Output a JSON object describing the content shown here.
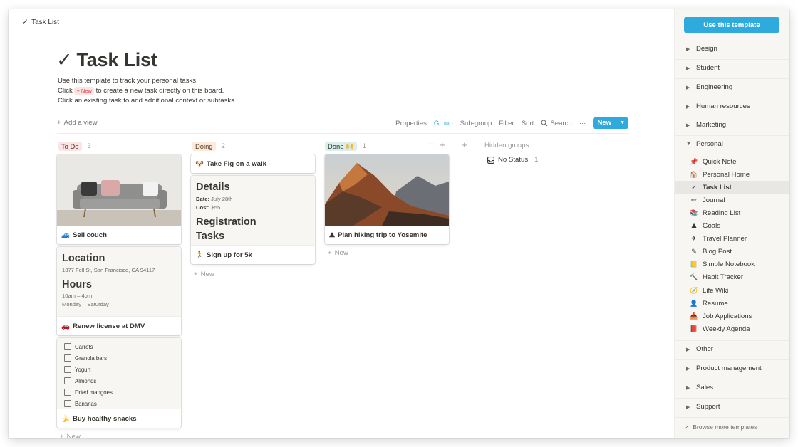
{
  "topbar": {
    "icon": "✓",
    "title": "Task List"
  },
  "page": {
    "title": "Task List",
    "title_icon": "✓",
    "description_line1": "Use this template to track your personal tasks.",
    "description_line2_pre": "Click",
    "description_line2_pill": "+ New",
    "description_line2_post": "to create a new task directly on this board.",
    "description_line3": "Click an existing task to add additional context or subtasks."
  },
  "viewbar": {
    "add_view": "Add a view",
    "properties": "Properties",
    "group": "Group",
    "subgroup": "Sub-group",
    "filter": "Filter",
    "sort": "Sort",
    "search": "Search",
    "more": "···",
    "new": "New"
  },
  "columns": [
    {
      "label": "To Do",
      "count": "3",
      "color": "#fbe4e4",
      "text_color": "#5a1e1e"
    },
    {
      "label": "Doing",
      "count": "2",
      "color": "#faebdd",
      "text_color": "#5a3a1a"
    },
    {
      "label": "Done 🙌",
      "count": "1",
      "color": "#ddedea",
      "text_color": "#1a3a2a"
    }
  ],
  "cards": {
    "sell_couch": {
      "emoji": "🚙",
      "title": "Sell couch"
    },
    "renew_license": {
      "emoji": "🚗",
      "title": "Renew license at DMV",
      "h1": "Location",
      "address": "1377 Fell St, San Francisco, CA 94117",
      "h2": "Hours",
      "hours1": "10am – 4pm",
      "hours2": "Monday – Saturday"
    },
    "snacks": {
      "emoji": "🍌",
      "title": "Buy healthy snacks",
      "items": [
        "Carrots",
        "Granola bars",
        "Yogurt",
        "Almonds",
        "Dried mangoes",
        "Bananas"
      ]
    },
    "fig_walk": {
      "emoji": "🐶",
      "title": "Take Fig on a walk"
    },
    "signup_5k": {
      "emoji": "🏃",
      "title": "Sign up for 5k",
      "h1": "Details",
      "date_label": "Date:",
      "date_value": "July 28th",
      "cost_label": "Cost:",
      "cost_value": "$55",
      "h2": "Registration",
      "h3": "Tasks"
    },
    "hiking": {
      "emoji": "⛰",
      "title": "Plan hiking trip to Yosemite"
    }
  },
  "board": {
    "new_label": "New",
    "hidden_groups": "Hidden groups",
    "no_status": "No Status",
    "no_status_count": "1",
    "col_more": "···",
    "add": "+"
  },
  "sidebar": {
    "use_template": "Use this template",
    "sections": [
      "Design",
      "Student",
      "Engineering",
      "Human resources",
      "Marketing",
      "Personal"
    ],
    "personal_items": [
      {
        "icon": "📌",
        "label": "Quick Note"
      },
      {
        "icon": "🏠",
        "label": "Personal Home"
      },
      {
        "icon": "✓",
        "label": "Task List"
      },
      {
        "icon": "✏",
        "label": "Journal"
      },
      {
        "icon": "📚",
        "label": "Reading List"
      },
      {
        "icon": "⛰",
        "label": "Goals"
      },
      {
        "icon": "✈",
        "label": "Travel Planner"
      },
      {
        "icon": "✎",
        "label": "Blog Post"
      },
      {
        "icon": "📒",
        "label": "Simple Notebook"
      },
      {
        "icon": "🔨",
        "label": "Habit Tracker"
      },
      {
        "icon": "🧭",
        "label": "Life Wiki"
      },
      {
        "icon": "👤",
        "label": "Resume"
      },
      {
        "icon": "📥",
        "label": "Job Applications"
      },
      {
        "icon": "📕",
        "label": "Weekly Agenda"
      }
    ],
    "sections_after": [
      "Other",
      "Product management",
      "Sales",
      "Support"
    ],
    "browse": "Browse more templates",
    "browse_icon": "↗"
  }
}
